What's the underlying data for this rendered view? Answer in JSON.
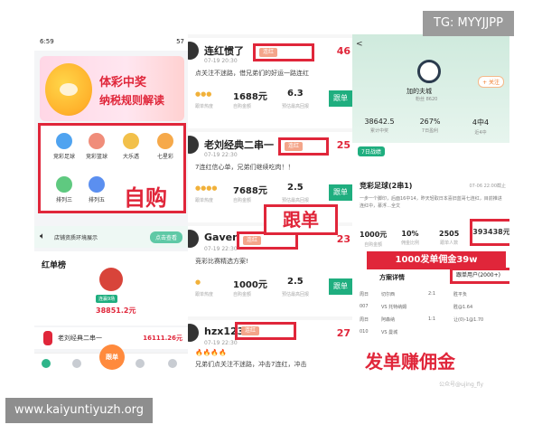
{
  "overlays": {
    "tg_label": "TG: MYYJJPP",
    "site_url": "www.kaiyuntiyuzh.org"
  },
  "left_screen": {
    "status_time": "6:59",
    "status_right": "57",
    "banner_line1": "体彩中奖",
    "banner_line2": "纳税规则解读",
    "self_buy_label": "自购",
    "games": [
      {
        "label": "竞彩足球",
        "color": "#4fa3f0"
      },
      {
        "label": "竞彩篮球",
        "color": "#f08d7a"
      },
      {
        "label": "大乐透",
        "color": "#f2c04a"
      },
      {
        "label": "七星彩",
        "color": "#f6a94a"
      },
      {
        "label": "排列三",
        "color": "#5fc980"
      },
      {
        "label": "排列五",
        "color": "#5b8ff0"
      }
    ],
    "notice_text": "店铺资质环境展示",
    "notice_button": "点击查看",
    "hongdan_title": "红单榜",
    "hongdan_tag": "连赢9场",
    "hongdan_amount": "38851.2元",
    "row_name": "老刘经典二串一",
    "row_value": "16111.26元",
    "fab_label": "跟单",
    "tab_labels": [
      "首页",
      "",
      "",
      "",
      ""
    ]
  },
  "middle_screen": {
    "cards": [
      {
        "name": "连红惯了",
        "time": "07-19 20:30",
        "streak": "连红",
        "right": "46",
        "desc": "点关注不迷路，借兄弟们的好运一路连红",
        "v1": "1688元",
        "v2": "6.3",
        "l0": "跟单热度",
        "l1": "自购金额",
        "l2": "预估最高回报",
        "follow": "跟单"
      },
      {
        "name": "老刘经典二串一",
        "time": "07-19 22:30",
        "streak": "连红",
        "right": "25",
        "desc": "7连红信心单，兄弟们继续吃肉！！",
        "v1": "7688元",
        "v2": "2.5",
        "l0": "跟单热度",
        "l1": "自购金额",
        "l2": "预估最高回报",
        "follow": "跟单"
      },
      {
        "name": "Gaven",
        "time": "07-19 22:30",
        "streak": "连红",
        "right": "23",
        "desc": "竞彩比赛精选方案!",
        "v1": "1000元",
        "v2": "2.5",
        "l0": "跟单热度",
        "l1": "自购金额",
        "l2": "预估最高回报",
        "follow": "跟单"
      },
      {
        "name": "hzx123",
        "time": "07-19 22:30",
        "streak": "连红",
        "right": "27",
        "desc": "兄弟们点关注不迷路，冲击7连红，冲击",
        "v1": "",
        "v2": "",
        "l0": "",
        "l1": "",
        "l2": "",
        "follow": ""
      }
    ],
    "overlay_label": "跟单"
  },
  "right_screen": {
    "back": "<",
    "follow": "+ 关注",
    "club": "加的夫城",
    "fans": "粉丝 8620",
    "stats": [
      {
        "v": "38642.5",
        "l": "累计中奖"
      },
      {
        "v": "267%",
        "l": "7日盈利"
      },
      {
        "v": "4中4",
        "l": "近4中"
      }
    ],
    "tab": "7日战绩",
    "plan_title": "竞彩足球(2串1)",
    "plan_time": "07-06 22:00截止",
    "plan_text": "一步一个脚印，后面16中14，昨天轻取日本喜旧蓝哥七连红，目前推进连红中，慕浮…全文",
    "plan_stats": [
      {
        "v": "1000元",
        "l": "自购金额"
      },
      {
        "v": "10%",
        "l": "佣金比例"
      },
      {
        "v": "2505",
        "l": "跟单人数"
      }
    ],
    "highlight_value": "393438元",
    "commission_banner": "1000发单佣金39w",
    "plan_detail": "方案详情",
    "follow_users": "跟单用户(2000+)",
    "table_rows": [
      {
        "a": "周日",
        "b": "切尔西",
        "c": "2:1",
        "d": "胜平负"
      },
      {
        "a": "007",
        "b": "VS 托特纳姆",
        "c": "",
        "d": "胜@1.64"
      },
      {
        "a": "周日",
        "b": "阿森纳",
        "c": "1:1",
        "d": "让(0)-1@1.70"
      },
      {
        "a": "010",
        "b": "VS 曼城",
        "c": "",
        "d": ""
      }
    ],
    "fadan_label": "发单赚佣金",
    "watermark": "公众号@ujing_fly"
  }
}
